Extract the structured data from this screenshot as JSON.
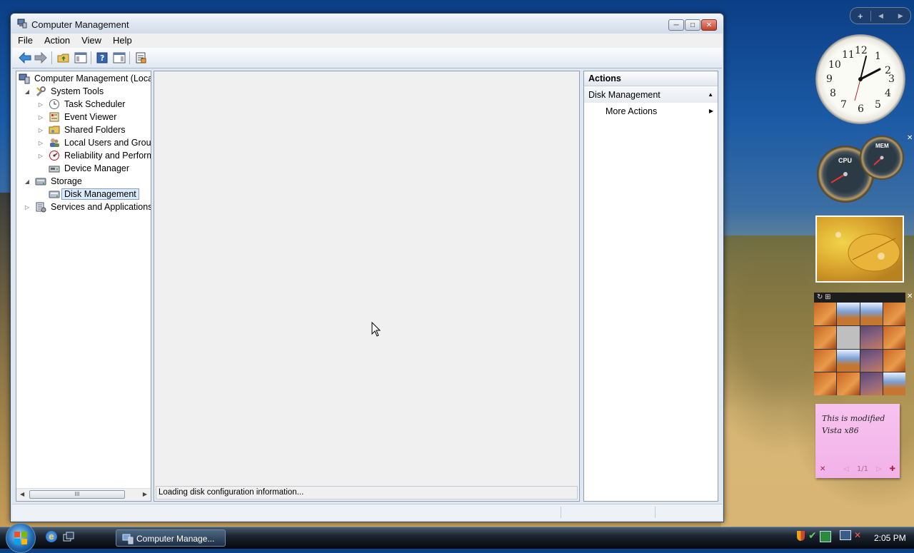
{
  "window": {
    "title": "Computer Management",
    "minimize_glyph": "─",
    "maximize_glyph": "□",
    "close_glyph": "✕"
  },
  "menu": [
    "File",
    "Action",
    "View",
    "Help"
  ],
  "toolbar": {
    "icons": [
      "back-icon",
      "forward-icon",
      "up-folder-icon",
      "show-hide-tree-icon",
      "help-icon",
      "show-hide-action-pane-icon",
      "properties-icon"
    ]
  },
  "tree": {
    "root": "Computer Management (Local)",
    "system_tools": "System Tools",
    "task_scheduler": "Task Scheduler",
    "event_viewer": "Event Viewer",
    "shared_folders": "Shared Folders",
    "local_users": "Local Users and Groups",
    "reliability": "Reliability and Performance",
    "device_manager": "Device Manager",
    "storage": "Storage",
    "disk_management": "Disk Management",
    "services_apps": "Services and Applications",
    "scroll_grip": "III"
  },
  "center": {
    "status": "Loading disk configuration information..."
  },
  "actions": {
    "header": "Actions",
    "section": "Disk Management",
    "more": "More Actions"
  },
  "desktop": {
    "sidebar_add": "+",
    "sidebar_prev": "◀",
    "sidebar_next": "▶",
    "clock_numbers": [
      "12",
      "1",
      "2",
      "3",
      "4",
      "5",
      "6",
      "7",
      "8",
      "9",
      "10",
      "11"
    ],
    "cpu_label": "CPU",
    "mem_label": "MEM",
    "note_text": "This is modified Vista x86",
    "note_page": "1/1",
    "note_delete": "✕",
    "note_add": "✚",
    "note_prev": "◁",
    "note_next": "▷"
  },
  "taskbar": {
    "task_label": "Computer Manage...",
    "time": "2:05 PM"
  },
  "colors": {
    "selection_bg": "#dcebfc",
    "selection_border": "#7da2ce",
    "pane_border": "#8e9fb3",
    "close_red": "#c2422b"
  }
}
